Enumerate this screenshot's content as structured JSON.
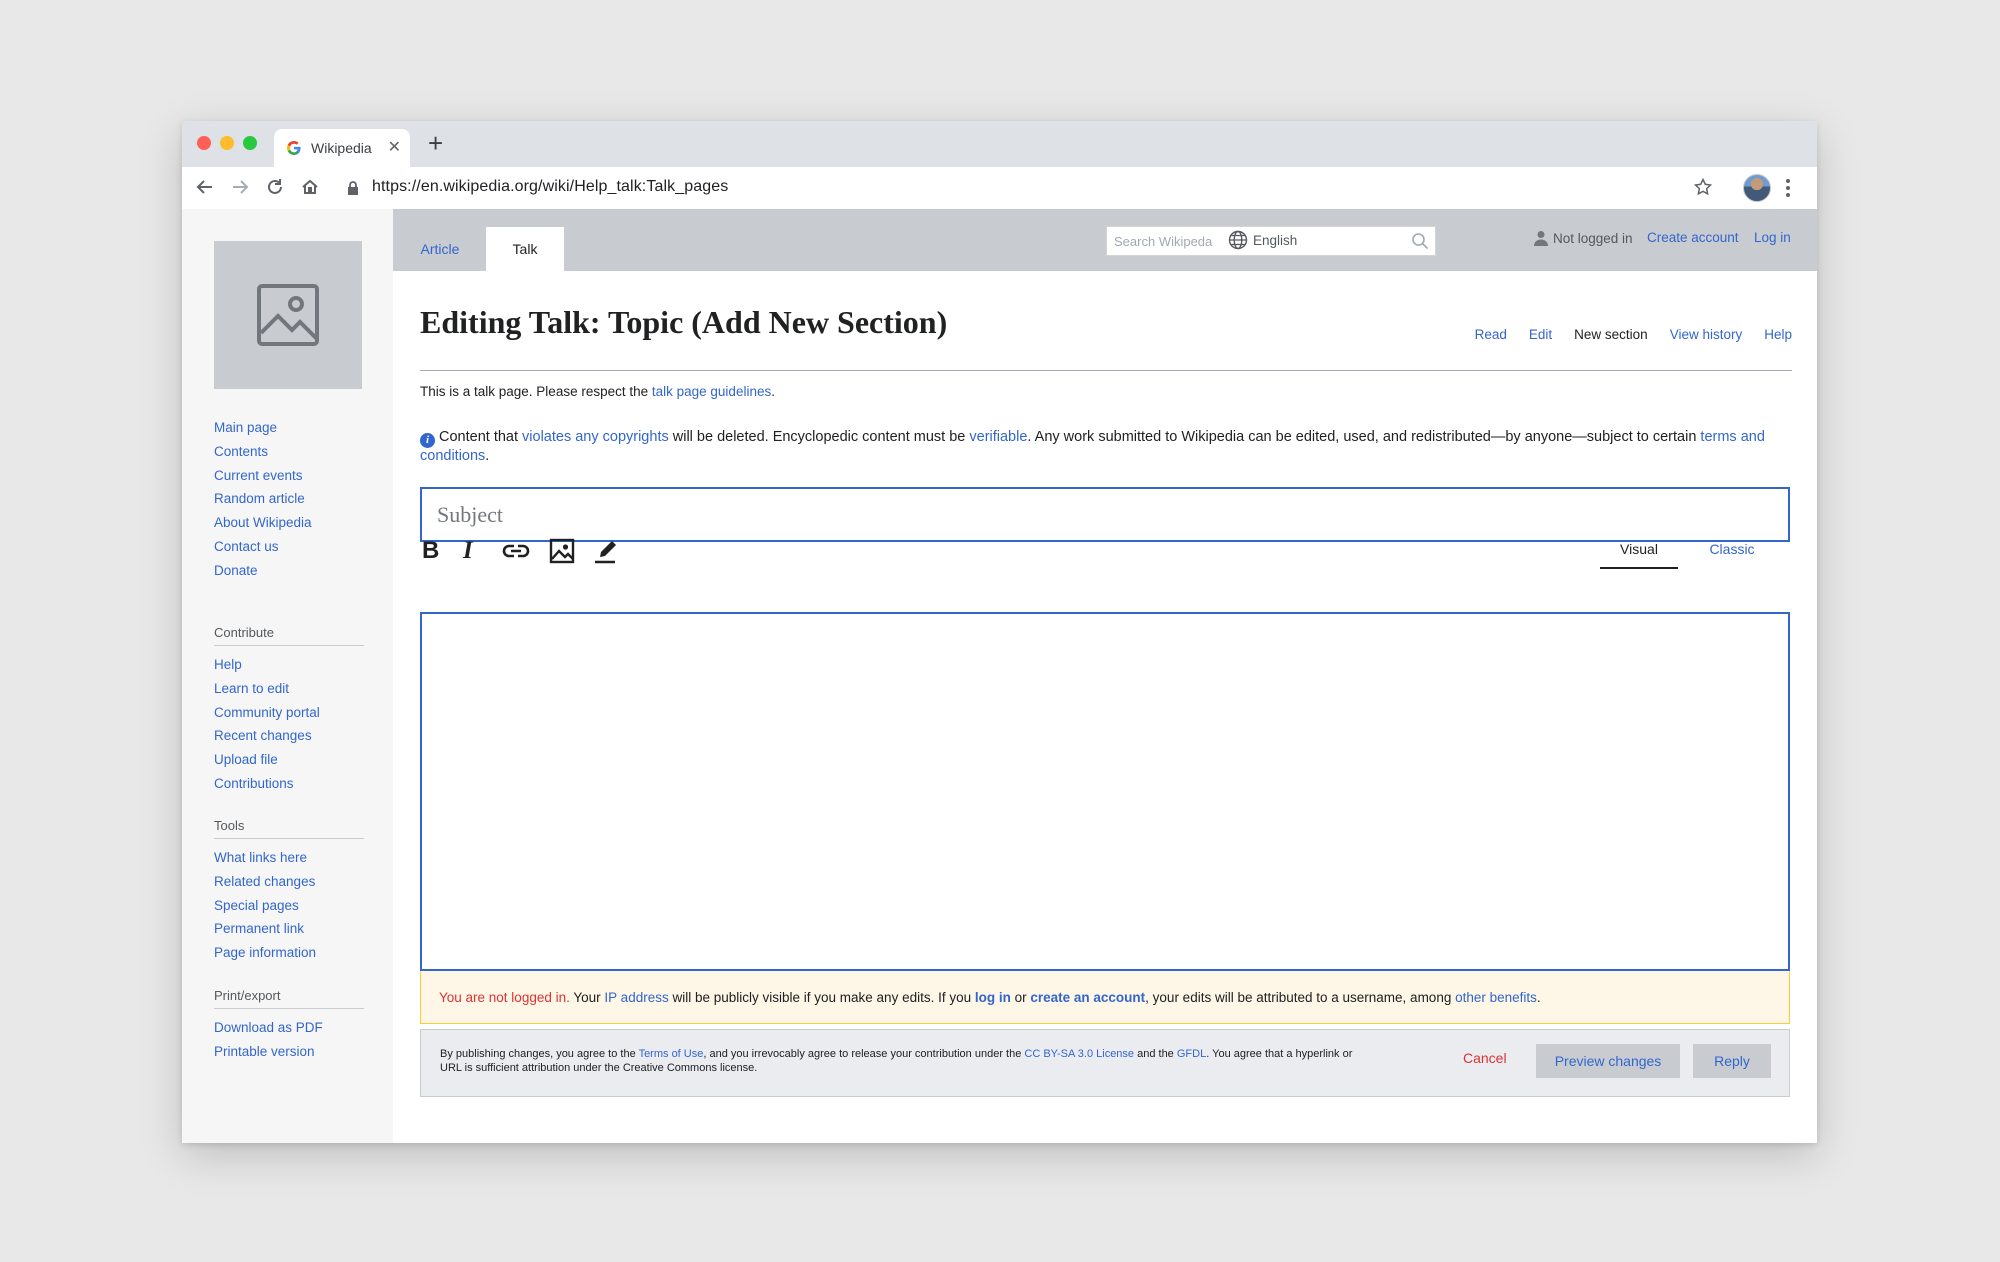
{
  "browser": {
    "tab_title": "Wikipedia",
    "url": "https://en.wikipedia.org/wiki/Help_talk:Talk_pages"
  },
  "sidebar": {
    "nav_links": [
      "Main page",
      "Contents",
      "Current events",
      "Random article",
      "About Wikipedia",
      "Contact us",
      "Donate"
    ],
    "sections": [
      {
        "heading": "Contribute",
        "links": [
          "Help",
          "Learn to edit",
          "Community portal",
          "Recent changes",
          "Upload file",
          "Contributions"
        ]
      },
      {
        "heading": "Tools",
        "links": [
          "What links here",
          "Related changes",
          "Special pages",
          "Permanent link",
          "Page information"
        ]
      },
      {
        "heading": "Print/export",
        "links": [
          "Download as PDF",
          "Printable version"
        ]
      }
    ]
  },
  "header": {
    "tabs": {
      "article": "Article",
      "talk": "Talk"
    },
    "search_placeholder": "Search Wikipeda",
    "language": "English",
    "not_logged_in": "Not logged in",
    "create_account": "Create account",
    "log_in": "Log in"
  },
  "page": {
    "title": "Editing Talk: Topic (Add New Section)",
    "actions": {
      "read": "Read",
      "edit": "Edit",
      "new_section": "New section",
      "view_history": "View history",
      "help": "Help"
    },
    "talk_notice": {
      "before": "This is a talk page. Please respect the ",
      "link": "talk page guidelines",
      "after": "."
    },
    "copyright_notice": {
      "t1": "Content that ",
      "l1": "violates any copyrights",
      "t2": " will be deleted. Encyclopedic content must be ",
      "l2": "verifiable",
      "t3": ". Any work submitted to Wikipedia can be edited, used, and redistributed—by anyone—subject to certain ",
      "l3": "terms and conditions",
      "t4": "."
    }
  },
  "editor": {
    "subject_placeholder": "Subject",
    "modes": {
      "visual": "Visual",
      "classic": "Classic"
    },
    "body_value": ""
  },
  "warning": {
    "red": "You are not logged in.",
    "t1": " Your ",
    "l1": "IP address",
    "t2": " will be publicly visible if you make any edits. If you ",
    "l2": "log in",
    "t3": " or ",
    "l3": "create an account",
    "t4": ", your edits will be attributed to a username, among ",
    "l4": "other benefits",
    "t5": "."
  },
  "publish": {
    "t1": "By publishing changes, you agree to the ",
    "l1": "Terms of Use",
    "t2": ", and you irrevocably agree to release your contribution under the ",
    "l2": "CC BY-SA 3.0 License",
    "t3": " and the ",
    "l3": "GFDL",
    "t4": ". You agree that a hyperlink or URL is sufficient attribution under the Creative Commons license.",
    "cancel": "Cancel",
    "preview": "Preview changes",
    "reply": "Reply"
  },
  "colors": {
    "link": "#3366cc",
    "warning_red": "#dd3333",
    "accent_border": "#3366cc"
  },
  "icons": [
    "google-icon",
    "close-icon",
    "plus-icon",
    "back-icon",
    "forward-icon",
    "reload-icon",
    "home-icon",
    "lock-icon",
    "star-icon",
    "kebab-menu-icon",
    "image-placeholder-icon",
    "search-icon",
    "globe-icon",
    "user-icon",
    "info-icon",
    "bold-icon",
    "italic-icon",
    "link-icon",
    "image-icon",
    "highlighter-icon"
  ]
}
